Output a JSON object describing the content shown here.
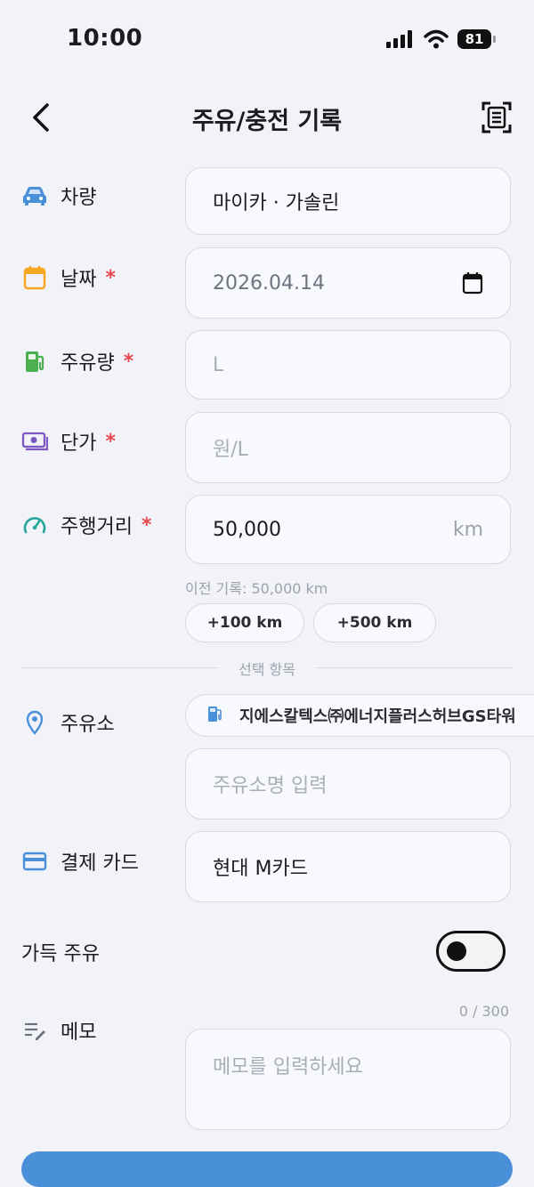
{
  "status_bar": {
    "time": "10:00",
    "battery": "81"
  },
  "header": {
    "title": "주유/충전 기록"
  },
  "form": {
    "vehicle": {
      "label": "차량",
      "value": "마이카 · 가솔린"
    },
    "date": {
      "label": "날짜",
      "required_mark": "*",
      "value": "2026.04.14"
    },
    "amount": {
      "label": "주유량",
      "required_mark": "*",
      "placeholder": "L"
    },
    "unit_price": {
      "label": "단가",
      "required_mark": "*",
      "placeholder": "원/L"
    },
    "odometer": {
      "label": "주행거리",
      "required_mark": "*",
      "value": "50,000",
      "unit": "km",
      "hint": "이전 기록: 50,000 km",
      "quick_add": [
        "+100 km",
        "+500 km"
      ]
    }
  },
  "optional_section": {
    "divider_label": "선택 항목"
  },
  "station": {
    "label": "주유소",
    "suggestion": "지에스칼텍스㈜에너지플러스허브GS타워",
    "placeholder": "주유소명 입력"
  },
  "card": {
    "label": "결제 카드",
    "value": "현대 M카드"
  },
  "full_fuel": {
    "label": "가득 주유",
    "enabled": false
  },
  "memo": {
    "label": "메모",
    "counter": "0 / 300",
    "placeholder": "메모를 입력하세요"
  },
  "colors": {
    "background": "#f2f3f8",
    "vehicle_icon": "#4a90d9",
    "date_icon": "#f5a623",
    "fuel_icon": "#4caf50",
    "price_icon": "#7e57c2",
    "odometer_icon": "#26a69a",
    "station_icon": "#4a90d9",
    "card_icon": "#4a90d9",
    "required": "#e5484d"
  },
  "icons": {
    "vehicle": "car-icon",
    "date": "calendar-icon",
    "amount": "fuel-pump-icon",
    "unit_price": "money-icon",
    "odometer": "speedometer-icon",
    "station": "location-pin-icon",
    "card": "credit-card-icon",
    "memo": "memo-edit-icon",
    "scan": "receipt-scan-icon"
  }
}
